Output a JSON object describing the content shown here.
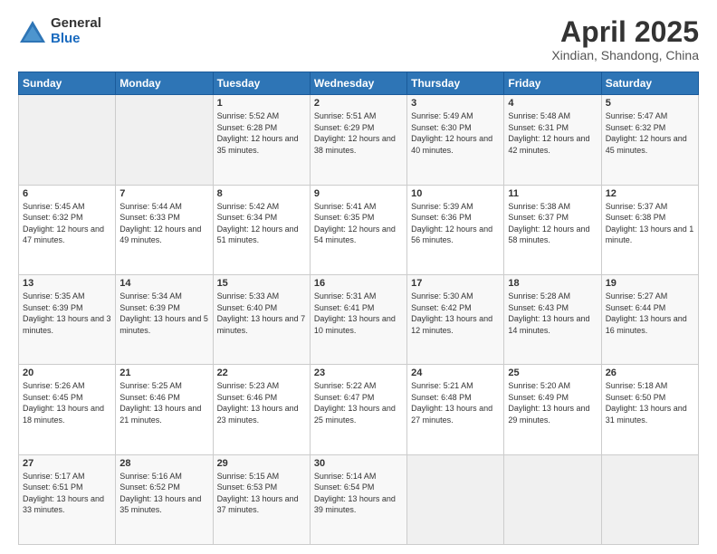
{
  "logo": {
    "general": "General",
    "blue": "Blue"
  },
  "header": {
    "title": "April 2025",
    "subtitle": "Xindian, Shandong, China"
  },
  "weekdays": [
    "Sunday",
    "Monday",
    "Tuesday",
    "Wednesday",
    "Thursday",
    "Friday",
    "Saturday"
  ],
  "weeks": [
    [
      null,
      null,
      {
        "day": "1",
        "sunrise": "Sunrise: 5:52 AM",
        "sunset": "Sunset: 6:28 PM",
        "daylight": "Daylight: 12 hours and 35 minutes."
      },
      {
        "day": "2",
        "sunrise": "Sunrise: 5:51 AM",
        "sunset": "Sunset: 6:29 PM",
        "daylight": "Daylight: 12 hours and 38 minutes."
      },
      {
        "day": "3",
        "sunrise": "Sunrise: 5:49 AM",
        "sunset": "Sunset: 6:30 PM",
        "daylight": "Daylight: 12 hours and 40 minutes."
      },
      {
        "day": "4",
        "sunrise": "Sunrise: 5:48 AM",
        "sunset": "Sunset: 6:31 PM",
        "daylight": "Daylight: 12 hours and 42 minutes."
      },
      {
        "day": "5",
        "sunrise": "Sunrise: 5:47 AM",
        "sunset": "Sunset: 6:32 PM",
        "daylight": "Daylight: 12 hours and 45 minutes."
      }
    ],
    [
      {
        "day": "6",
        "sunrise": "Sunrise: 5:45 AM",
        "sunset": "Sunset: 6:32 PM",
        "daylight": "Daylight: 12 hours and 47 minutes."
      },
      {
        "day": "7",
        "sunrise": "Sunrise: 5:44 AM",
        "sunset": "Sunset: 6:33 PM",
        "daylight": "Daylight: 12 hours and 49 minutes."
      },
      {
        "day": "8",
        "sunrise": "Sunrise: 5:42 AM",
        "sunset": "Sunset: 6:34 PM",
        "daylight": "Daylight: 12 hours and 51 minutes."
      },
      {
        "day": "9",
        "sunrise": "Sunrise: 5:41 AM",
        "sunset": "Sunset: 6:35 PM",
        "daylight": "Daylight: 12 hours and 54 minutes."
      },
      {
        "day": "10",
        "sunrise": "Sunrise: 5:39 AM",
        "sunset": "Sunset: 6:36 PM",
        "daylight": "Daylight: 12 hours and 56 minutes."
      },
      {
        "day": "11",
        "sunrise": "Sunrise: 5:38 AM",
        "sunset": "Sunset: 6:37 PM",
        "daylight": "Daylight: 12 hours and 58 minutes."
      },
      {
        "day": "12",
        "sunrise": "Sunrise: 5:37 AM",
        "sunset": "Sunset: 6:38 PM",
        "daylight": "Daylight: 13 hours and 1 minute."
      }
    ],
    [
      {
        "day": "13",
        "sunrise": "Sunrise: 5:35 AM",
        "sunset": "Sunset: 6:39 PM",
        "daylight": "Daylight: 13 hours and 3 minutes."
      },
      {
        "day": "14",
        "sunrise": "Sunrise: 5:34 AM",
        "sunset": "Sunset: 6:39 PM",
        "daylight": "Daylight: 13 hours and 5 minutes."
      },
      {
        "day": "15",
        "sunrise": "Sunrise: 5:33 AM",
        "sunset": "Sunset: 6:40 PM",
        "daylight": "Daylight: 13 hours and 7 minutes."
      },
      {
        "day": "16",
        "sunrise": "Sunrise: 5:31 AM",
        "sunset": "Sunset: 6:41 PM",
        "daylight": "Daylight: 13 hours and 10 minutes."
      },
      {
        "day": "17",
        "sunrise": "Sunrise: 5:30 AM",
        "sunset": "Sunset: 6:42 PM",
        "daylight": "Daylight: 13 hours and 12 minutes."
      },
      {
        "day": "18",
        "sunrise": "Sunrise: 5:28 AM",
        "sunset": "Sunset: 6:43 PM",
        "daylight": "Daylight: 13 hours and 14 minutes."
      },
      {
        "day": "19",
        "sunrise": "Sunrise: 5:27 AM",
        "sunset": "Sunset: 6:44 PM",
        "daylight": "Daylight: 13 hours and 16 minutes."
      }
    ],
    [
      {
        "day": "20",
        "sunrise": "Sunrise: 5:26 AM",
        "sunset": "Sunset: 6:45 PM",
        "daylight": "Daylight: 13 hours and 18 minutes."
      },
      {
        "day": "21",
        "sunrise": "Sunrise: 5:25 AM",
        "sunset": "Sunset: 6:46 PM",
        "daylight": "Daylight: 13 hours and 21 minutes."
      },
      {
        "day": "22",
        "sunrise": "Sunrise: 5:23 AM",
        "sunset": "Sunset: 6:46 PM",
        "daylight": "Daylight: 13 hours and 23 minutes."
      },
      {
        "day": "23",
        "sunrise": "Sunrise: 5:22 AM",
        "sunset": "Sunset: 6:47 PM",
        "daylight": "Daylight: 13 hours and 25 minutes."
      },
      {
        "day": "24",
        "sunrise": "Sunrise: 5:21 AM",
        "sunset": "Sunset: 6:48 PM",
        "daylight": "Daylight: 13 hours and 27 minutes."
      },
      {
        "day": "25",
        "sunrise": "Sunrise: 5:20 AM",
        "sunset": "Sunset: 6:49 PM",
        "daylight": "Daylight: 13 hours and 29 minutes."
      },
      {
        "day": "26",
        "sunrise": "Sunrise: 5:18 AM",
        "sunset": "Sunset: 6:50 PM",
        "daylight": "Daylight: 13 hours and 31 minutes."
      }
    ],
    [
      {
        "day": "27",
        "sunrise": "Sunrise: 5:17 AM",
        "sunset": "Sunset: 6:51 PM",
        "daylight": "Daylight: 13 hours and 33 minutes."
      },
      {
        "day": "28",
        "sunrise": "Sunrise: 5:16 AM",
        "sunset": "Sunset: 6:52 PM",
        "daylight": "Daylight: 13 hours and 35 minutes."
      },
      {
        "day": "29",
        "sunrise": "Sunrise: 5:15 AM",
        "sunset": "Sunset: 6:53 PM",
        "daylight": "Daylight: 13 hours and 37 minutes."
      },
      {
        "day": "30",
        "sunrise": "Sunrise: 5:14 AM",
        "sunset": "Sunset: 6:54 PM",
        "daylight": "Daylight: 13 hours and 39 minutes."
      },
      null,
      null,
      null
    ]
  ]
}
